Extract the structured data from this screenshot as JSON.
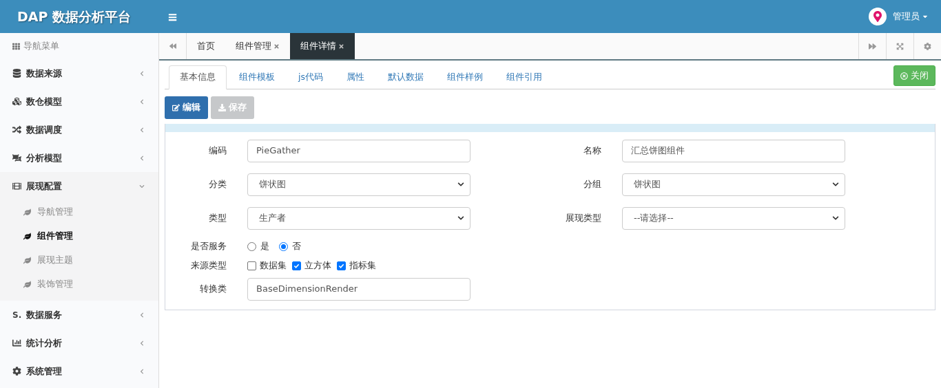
{
  "header": {
    "logo": "DAP 数据分析平台",
    "menu_glyph": "≡",
    "user": "管理员"
  },
  "sidebar": {
    "title": "导航菜单",
    "items": [
      {
        "label": "数据来源",
        "expanded": false
      },
      {
        "label": "数仓模型",
        "expanded": false
      },
      {
        "label": "数据调度",
        "expanded": false
      },
      {
        "label": "分析模型",
        "expanded": false
      },
      {
        "label": "展现配置",
        "expanded": true,
        "children": [
          {
            "label": "导航管理",
            "selected": false
          },
          {
            "label": "组件管理",
            "selected": true
          },
          {
            "label": "展现主题",
            "selected": false
          },
          {
            "label": "装饰管理",
            "selected": false
          }
        ]
      },
      {
        "label": "数据服务",
        "icon_text": "S.",
        "expanded": false
      },
      {
        "label": "统计分析",
        "expanded": false
      },
      {
        "label": "系统管理",
        "expanded": false
      }
    ]
  },
  "page_tabs": [
    {
      "label": "首页",
      "closable": false,
      "selected": false
    },
    {
      "label": "组件管理",
      "closable": true,
      "selected": false
    },
    {
      "label": "组件详情",
      "closable": true,
      "selected": true
    }
  ],
  "detail_tabs": [
    {
      "label": "基本信息",
      "selected": true
    },
    {
      "label": "组件模板",
      "selected": false
    },
    {
      "label": "js代码",
      "selected": false
    },
    {
      "label": "属性",
      "selected": false
    },
    {
      "label": "默认数据",
      "selected": false
    },
    {
      "label": "组件样例",
      "selected": false
    },
    {
      "label": "组件引用",
      "selected": false
    }
  ],
  "close_button": "关闭",
  "toolbar": [
    {
      "label": "编辑",
      "disabled": false
    },
    {
      "label": "保存",
      "disabled": true
    }
  ],
  "form": {
    "rows": [
      {
        "fields": [
          {
            "kind": "text",
            "label": "编码",
            "value": "PieGather"
          },
          {
            "kind": "text",
            "label": "名称",
            "value": "汇总饼图组件"
          }
        ]
      },
      {
        "fields": [
          {
            "kind": "select",
            "label": "分类",
            "value": "饼状图"
          },
          {
            "kind": "select",
            "label": "分组",
            "value": "饼状图"
          }
        ]
      },
      {
        "fields": [
          {
            "kind": "select",
            "label": "类型",
            "value": "生产者"
          },
          {
            "kind": "select",
            "label": "展现类型",
            "value": "--请选择--"
          }
        ]
      },
      {
        "fields": [
          {
            "kind": "radio",
            "label": "是否服务",
            "options": [
              {
                "label": "是",
                "selected": false
              },
              {
                "label": "否",
                "selected": true
              }
            ]
          }
        ]
      },
      {
        "fields": [
          {
            "kind": "checkbox",
            "label": "来源类型",
            "options": [
              {
                "label": "数据集",
                "checked": false
              },
              {
                "label": "立方体",
                "checked": true
              },
              {
                "label": "指标集",
                "checked": true
              }
            ]
          }
        ]
      },
      {
        "fields": [
          {
            "kind": "text",
            "label": "转换类",
            "value": "BaseDimensionRender"
          }
        ]
      }
    ]
  }
}
